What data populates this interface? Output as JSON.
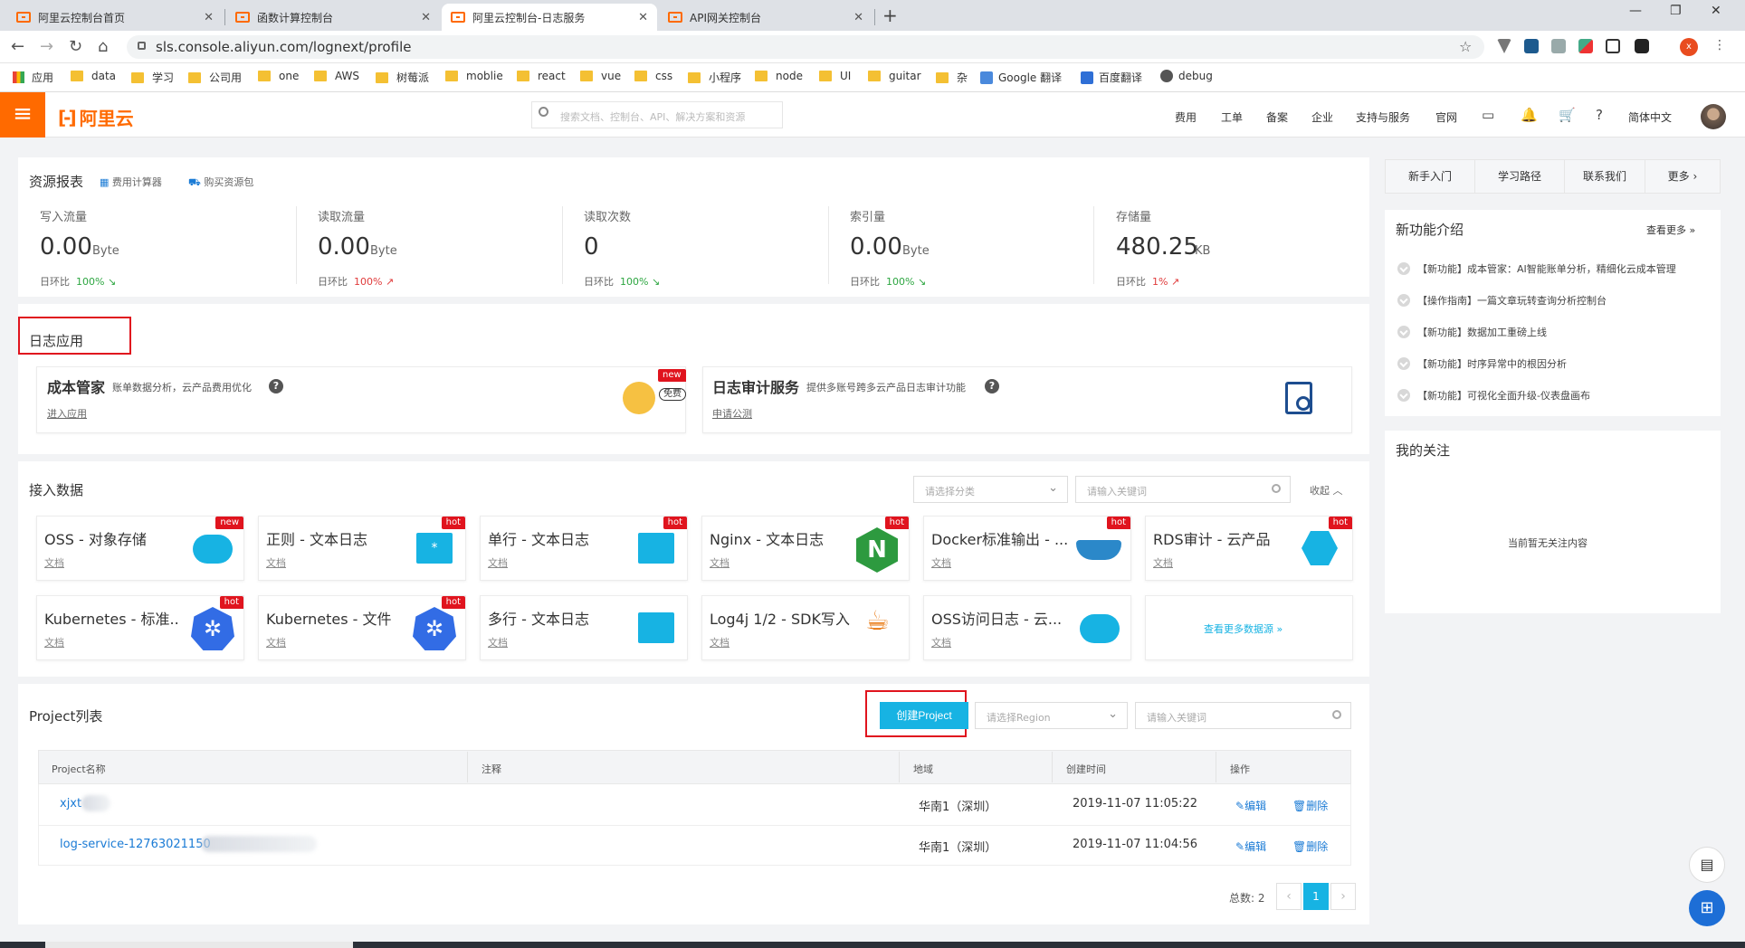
{
  "browser": {
    "tabs": [
      {
        "title": "阿里云控制台首页"
      },
      {
        "title": "函数计算控制台"
      },
      {
        "title": "阿里云控制台-日志服务"
      },
      {
        "title": "API网关控制台"
      }
    ],
    "url": "sls.console.aliyun.com/lognext/profile",
    "bookmarks": [
      "应用",
      "data",
      "学习",
      "公司用",
      "one",
      "AWS",
      "树莓派",
      "moblie",
      "react",
      "vue",
      "css",
      "小程序",
      "node",
      "UI",
      "guitar",
      "杂",
      "Google 翻译",
      "百度翻译",
      "debug"
    ],
    "profile_initial": "x"
  },
  "header": {
    "logo_text": "阿里云",
    "search_placeholder": "搜索文档、控制台、API、解决方案和资源",
    "nav": [
      "费用",
      "工单",
      "备案",
      "企业",
      "支持与服务",
      "官网"
    ],
    "language": "简体中文"
  },
  "resources": {
    "title": "资源报表",
    "calc_link": "费用计算器",
    "buy_link": "购买资源包",
    "compare_label": "日环比",
    "stats": [
      {
        "label": "写入流量",
        "value": "0.00",
        "unit": "Byte",
        "change": "100%",
        "direction": "down"
      },
      {
        "label": "读取流量",
        "value": "0.00",
        "unit": "Byte",
        "change": "100%",
        "direction": "up"
      },
      {
        "label": "读取次数",
        "value": "0",
        "unit": "",
        "change": "100%",
        "direction": "down"
      },
      {
        "label": "索引量",
        "value": "0.00",
        "unit": "Byte",
        "change": "100%",
        "direction": "down"
      },
      {
        "label": "存储量",
        "value": "480.25",
        "unit": "KB",
        "change": "1%",
        "direction": "up"
      }
    ]
  },
  "log_apps": {
    "title": "日志应用",
    "apps": [
      {
        "name": "成本管家",
        "desc": "账单数据分析，云产品费用优化",
        "link": "进入应用",
        "badge": "new",
        "tag": "免费"
      },
      {
        "name": "日志审计服务",
        "desc": "提供多账号跨多云产品日志审计功能",
        "link": "申请公测"
      }
    ]
  },
  "ingest": {
    "title": "接入数据",
    "category_placeholder": "请选择分类",
    "keyword_placeholder": "请输入关键词",
    "collapse": "收起",
    "doc_label": "文档",
    "more_sources": "查看更多数据源",
    "sources": [
      {
        "name": "OSS - 对象存储",
        "badge": "new",
        "icon": "oss-cloud-icon",
        "color": "#17b3e3"
      },
      {
        "name": "正则 - 文本日志",
        "badge": "hot",
        "icon": "regex-file-icon",
        "color": "#17b3e3"
      },
      {
        "name": "单行 - 文本日志",
        "badge": "hot",
        "icon": "file-icon",
        "color": "#17b3e3"
      },
      {
        "name": "Nginx - 文本日志",
        "badge": "hot",
        "icon": "nginx-icon",
        "color": "#2d9a3f"
      },
      {
        "name": "Docker标准输出 - ...",
        "badge": "hot",
        "icon": "docker-icon",
        "color": "#2b88c9"
      },
      {
        "name": "RDS审计 - 云产品",
        "badge": "hot",
        "icon": "rds-icon",
        "color": "#17b3e3"
      },
      {
        "name": "Kubernetes - 标准...",
        "badge": "hot",
        "icon": "kubernetes-icon",
        "color": "#326ce5"
      },
      {
        "name": "Kubernetes - 文件",
        "badge": "hot",
        "icon": "kubernetes-icon",
        "color": "#326ce5"
      },
      {
        "name": "多行 - 文本日志",
        "badge": "",
        "icon": "file-icon",
        "color": "#17b3e3"
      },
      {
        "name": "Log4j 1/2 - SDK写入",
        "badge": "",
        "icon": "java-icon",
        "color": "#e76f00"
      },
      {
        "name": "OSS访问日志 - 云...",
        "badge": "",
        "icon": "oss-cloud-icon",
        "color": "#17b3e3"
      }
    ]
  },
  "projects": {
    "title": "Project列表",
    "create_button": "创建Project",
    "region_placeholder": "请选择Region",
    "keyword_placeholder": "请输入关键词",
    "columns": [
      "Project名称",
      "注释",
      "地域",
      "创建时间",
      "操作"
    ],
    "rows": [
      {
        "name": "xjxt",
        "note": "",
        "region": "华南1（深圳）",
        "created": "2019-11-07 11:05:22",
        "edit": "编辑",
        "delete": "删除"
      },
      {
        "name": "log-service-12763021150",
        "note": "",
        "region": "华南1（深圳）",
        "created": "2019-11-07 11:04:56",
        "edit": "编辑",
        "delete": "删除"
      }
    ],
    "total_label": "总数: 2",
    "current_page": "1"
  },
  "sidebar": {
    "quick_tabs": [
      "新手入门",
      "学习路径",
      "联系我们",
      "更多"
    ],
    "features_title": "新功能介绍",
    "features_more": "查看更多",
    "features": [
      "【新功能】成本管家：AI智能账单分析，精细化云成本管理",
      "【操作指南】一篇文章玩转查询分析控制台",
      "【新功能】数据加工重磅上线",
      "【新功能】时序异常中的根因分析",
      "【新功能】可视化全面升级-仪表盘画布"
    ],
    "follow_title": "我的关注",
    "follow_empty": "当前暂无关注内容"
  },
  "colors": {
    "brand": "#ff6a00",
    "accent": "#17b3e3",
    "link": "#1b7bd5",
    "highlight": "#e0141e"
  }
}
